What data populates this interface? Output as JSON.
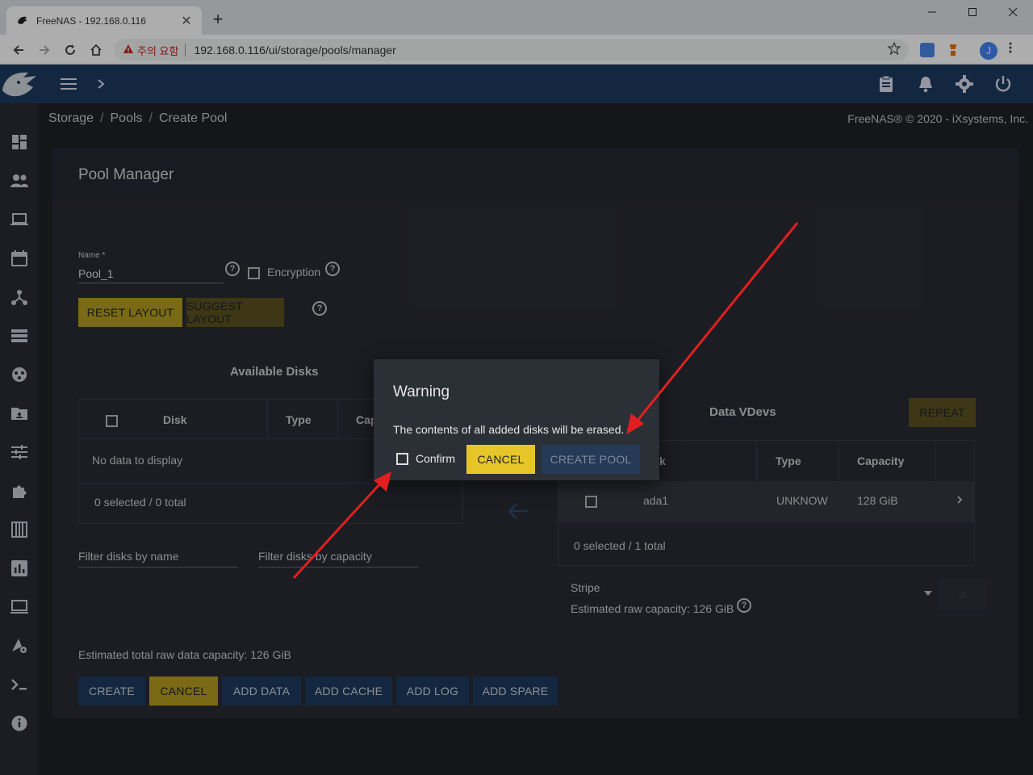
{
  "browser": {
    "tab_title": "FreeNAS - 192.168.0.116",
    "close_tab": "✕",
    "new_tab": "+",
    "security_warning": "주의 요함",
    "url": "192.168.0.116/ui/storage/pools/manager",
    "profile_initial": "J"
  },
  "breadcrumb": {
    "items": [
      "Storage",
      "Pools",
      "Create Pool"
    ],
    "separator": "/"
  },
  "copyright": "FreeNAS® © 2020 - iXsystems, Inc.",
  "pool_manager": {
    "title": "Pool Manager",
    "name_label": "Name *",
    "name_value": "Pool_1",
    "encryption_label": "Encryption",
    "reset_layout": "RESET LAYOUT",
    "suggest_layout": "SUGGEST LAYOUT"
  },
  "available_disks": {
    "title": "Available Disks",
    "columns": [
      "Disk",
      "Type",
      "Cap"
    ],
    "empty_text": "No data to display",
    "footer": "0 selected / 0 total",
    "filter_name": "Filter disks by name",
    "filter_capacity": "Filter disks by capacity"
  },
  "data_vdevs": {
    "title": "Data VDevs",
    "repeat": "REPEAT",
    "columns": [
      "k",
      "Type",
      "Capacity"
    ],
    "rows": [
      {
        "disk": "ada1",
        "type": "UNKNOW",
        "capacity": "128 GiB"
      }
    ],
    "footer": "0 selected / 1 total",
    "layout": "Stripe",
    "estimated": "Estimated raw capacity: 126 GiB"
  },
  "footer": {
    "estimated_total": "Estimated total raw data capacity: 126 GiB",
    "buttons": {
      "create": "CREATE",
      "cancel": "CANCEL",
      "add_data": "ADD DATA",
      "add_cache": "ADD CACHE",
      "add_log": "ADD LOG",
      "add_spare": "ADD SPARE"
    }
  },
  "dialog": {
    "title": "Warning",
    "message": "The contents of all added disks will be erased.",
    "confirm_label": "Confirm",
    "cancel": "CANCEL",
    "create_pool": "CREATE POOL"
  },
  "colors": {
    "header": "#1e3a5f",
    "accent_yellow": "#e6c52a",
    "annotation_arrow": "#e02020"
  }
}
